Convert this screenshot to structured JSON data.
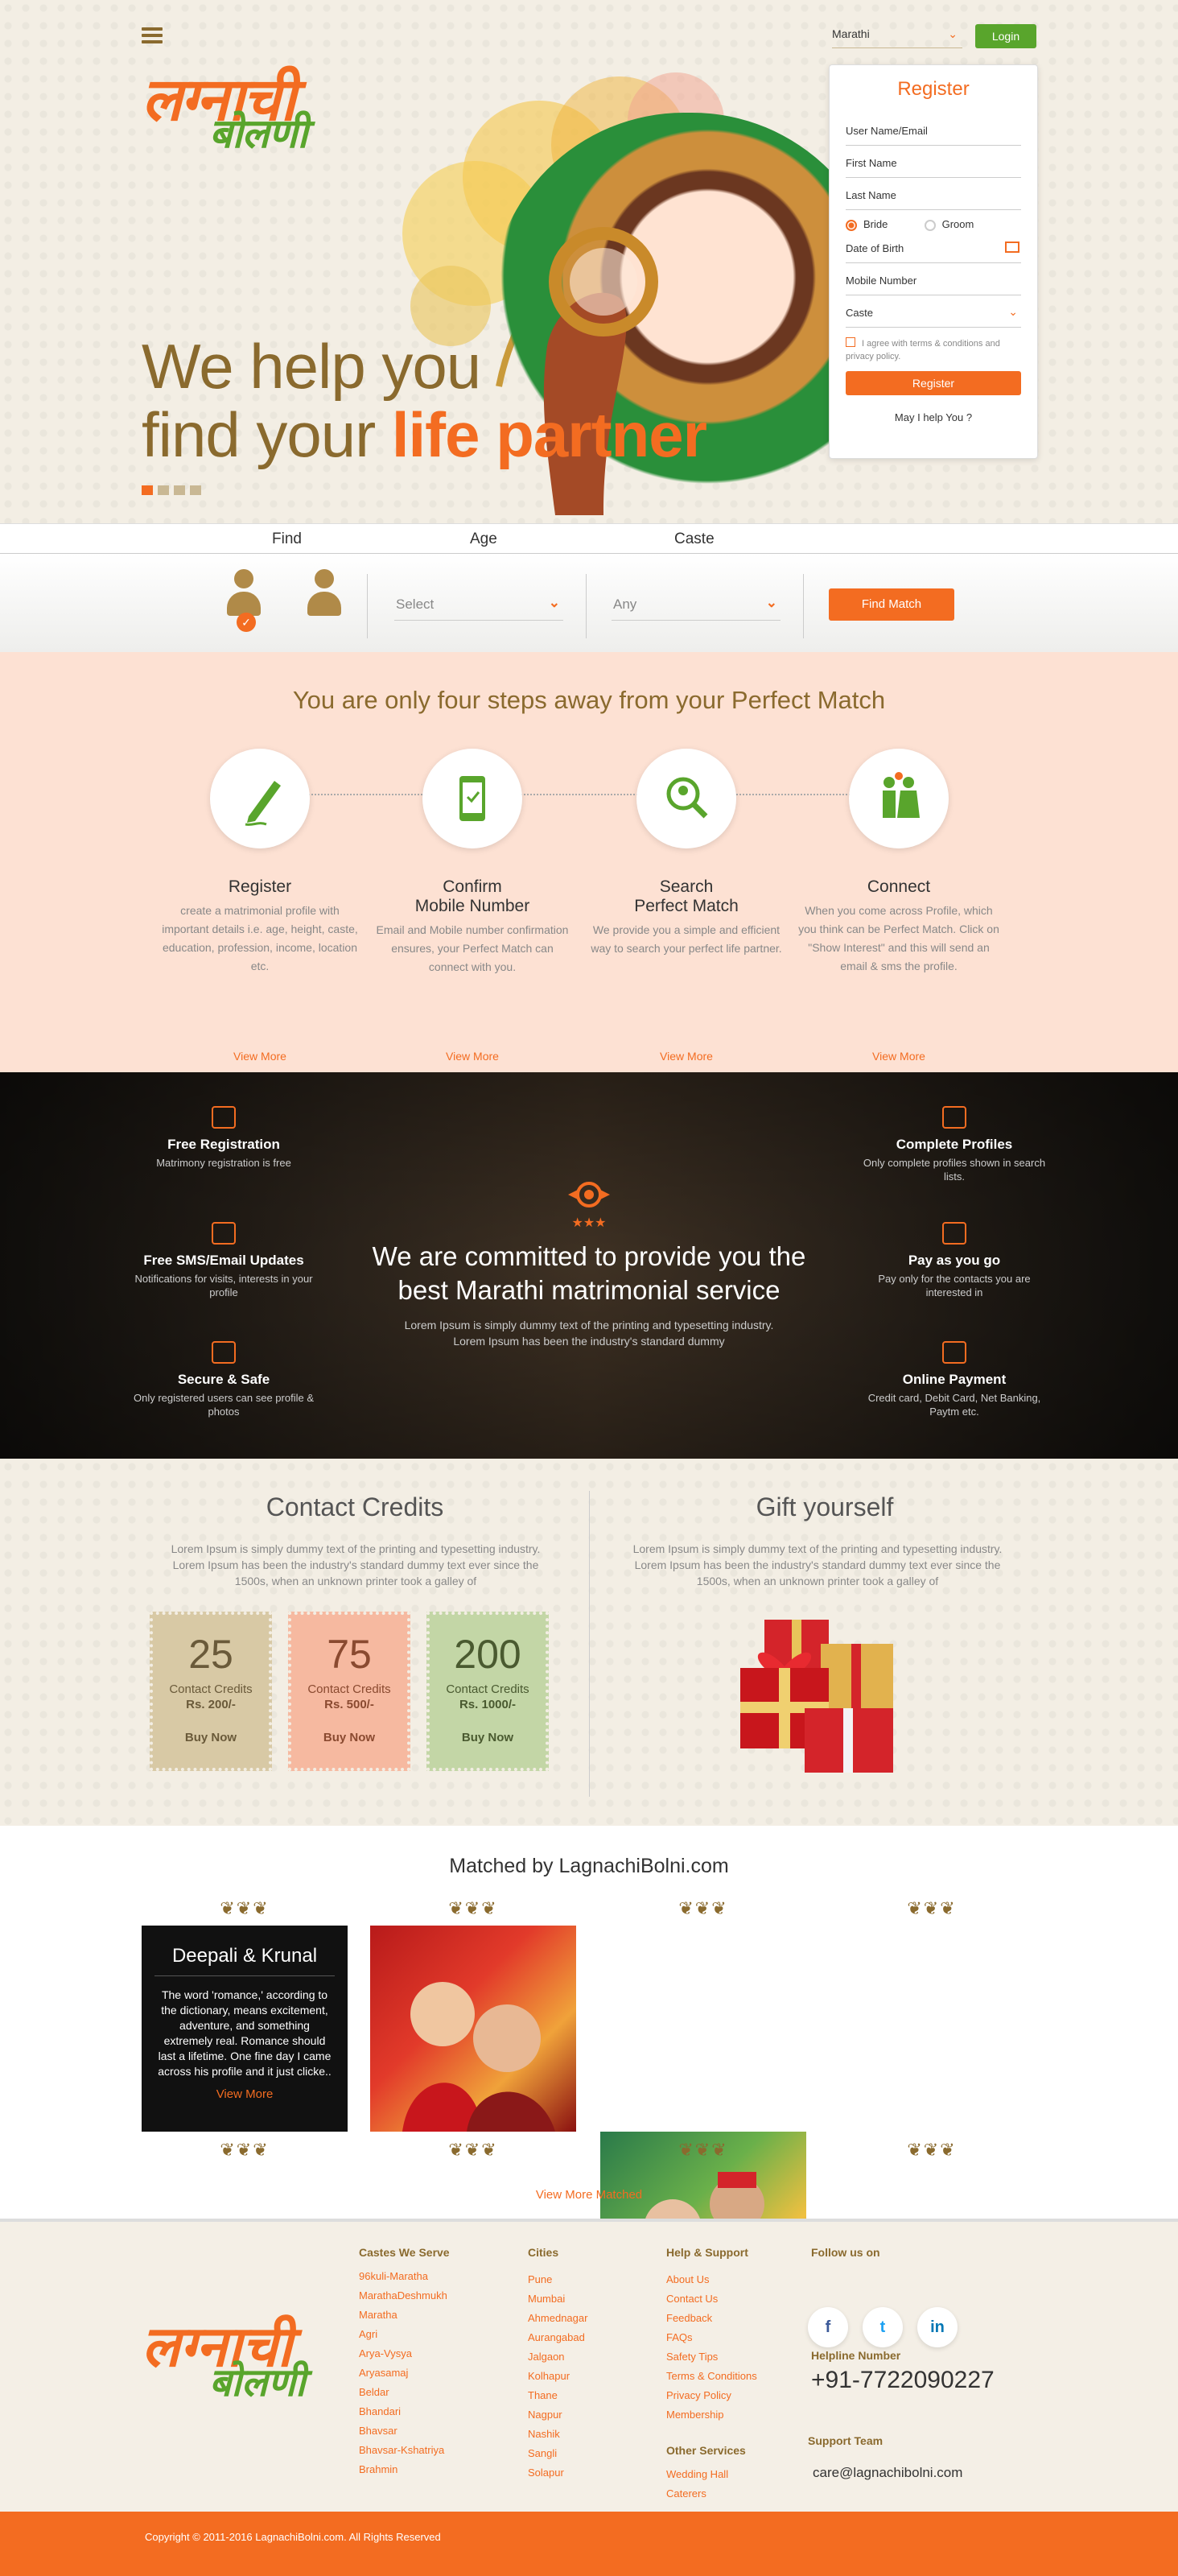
{
  "header": {
    "logo_line1": "लग्नाची",
    "logo_line2": "बोलणी",
    "language": "Marathi",
    "login_label": "Login",
    "hero_line1": "We help you",
    "hero_line2_plain": "find your ",
    "hero_line2_accent": "life partner"
  },
  "register": {
    "title": "Register",
    "username": "User Name/Email",
    "first_name": "First Name",
    "last_name": "Last Name",
    "gender_bride": "Bride",
    "gender_groom": "Groom",
    "dob": "Date of Birth",
    "mobile": "Mobile Number",
    "caste": "Caste",
    "agree": "I agree with terms & conditions and privacy policy.",
    "button": "Register",
    "help": "May I help You ?"
  },
  "search": {
    "label_find": "Find",
    "label_age": "Age",
    "label_caste": "Caste",
    "age_value": "Select",
    "caste_value": "Any",
    "button": "Find Match"
  },
  "steps": {
    "title": "You are only four steps away from your Perfect Match",
    "items": [
      {
        "title": "Register",
        "text": "create a matrimonial profile with important details i.e. age, height, caste, education, profession, income, location etc.",
        "link": "View More"
      },
      {
        "title": "Confirm\nMobile Number",
        "text": "Email and Mobile number confirmation ensures, your Perfect Match can connect with you.",
        "link": "View More"
      },
      {
        "title": "Search\nPerfect Match",
        "text": "We provide you a simple and efficient way to search your perfect life partner.",
        "link": "View More"
      },
      {
        "title": "Connect",
        "text": "When you come across Profile, which you think can be Perfect Match. Click on \"Show Interest\" and this will send an email & sms the profile.",
        "link": "View More"
      }
    ]
  },
  "commit": {
    "title": "We are committed to provide you the best Marathi matrimonial service",
    "text": "Lorem Ipsum is simply dummy text of the printing and typesetting industry. Lorem Ipsum has been the industry's standard dummy",
    "features": [
      {
        "title": "Free Registration",
        "text": "Matrimony registration is free"
      },
      {
        "title": "Free SMS/Email Updates",
        "text": "Notifications for visits, interests in your profile"
      },
      {
        "title": "Secure & Safe",
        "text": "Only registered users can see profile & photos"
      },
      {
        "title": "Complete Profiles",
        "text": "Only complete profiles shown in search lists."
      },
      {
        "title": "Pay as you go",
        "text": "Pay only for the contacts you are interested in"
      },
      {
        "title": "Online Payment",
        "text": "Credit card, Debit Card, Net Banking, Paytm etc."
      }
    ]
  },
  "credits": {
    "title": "Contact Credits",
    "text": "Lorem Ipsum is simply dummy text of the printing and typesetting industry. Lorem Ipsum has been the industry's standard dummy text ever since the 1500s, when an unknown printer took a galley of",
    "packs": [
      {
        "num": "25",
        "label": "Contact Credits",
        "price": "Rs. 200/-",
        "buy": "Buy Now",
        "color": "#d8c9a5",
        "text_color": "#6a5a3a"
      },
      {
        "num": "75",
        "label": "Contact Credits",
        "price": "Rs. 500/-",
        "buy": "Buy Now",
        "color": "#f6b9a0",
        "text_color": "#8a4a30"
      },
      {
        "num": "200",
        "label": "Contact Credits",
        "price": "Rs. 1000/-",
        "buy": "Buy Now",
        "color": "#c3d6a6",
        "text_color": "#4a5a30"
      }
    ]
  },
  "gift": {
    "title": "Gift yourself",
    "text": "Lorem Ipsum is simply dummy text of the printing and typesetting industry. Lorem Ipsum has been the industry's standard dummy text ever since the 1500s, when an unknown printer took a galley of"
  },
  "matched": {
    "title": "Matched by LagnachiBolni.com",
    "story_names": "Deepali & Krunal",
    "story_text": "The word 'romance,' according to the dictionary, means excitement, adventure, and something extremely real. Romance should last a lifetime. One fine day I came across his profile and it just clicke..",
    "story_link": "View More",
    "view_more": "View More Matched"
  },
  "footer": {
    "castes_title": "Castes We Serve",
    "castes": [
      "96kuli-Maratha",
      "MarathaDeshmukh",
      "Maratha",
      "Agri",
      "Arya-Vysya",
      "Aryasamaj",
      "Beldar",
      "Bhandari",
      "Bhavsar",
      "Bhavsar-Kshatriya",
      "Brahmin"
    ],
    "cities_title": "Cities",
    "cities": [
      "Pune",
      "Mumbai",
      "Ahmednagar",
      "Aurangabad",
      "Jalgaon",
      "Kolhapur",
      "Thane",
      "Nagpur",
      "Nashik",
      "Sangli",
      "Solapur"
    ],
    "help_title": "Help & Support",
    "help": [
      "About Us",
      "Contact Us",
      "Feedback",
      "FAQs",
      "Safety Tips",
      "Terms & Conditions",
      "Privacy Policy",
      "Membership"
    ],
    "other_title": "Other Services",
    "other": [
      "Wedding Hall",
      "Caterers"
    ],
    "follow_title": "Follow us on",
    "social": [
      "f",
      "t",
      "in"
    ],
    "helpline_title": "Helpline Number",
    "helpline": "+91-7722090227",
    "support_title": "Support Team",
    "support_email": "care@lagnachibolni.com",
    "copyright": "Copyright © 2011-2016 LagnachiBolni.com. All Rights Reserved"
  },
  "colors": {
    "accent": "#f36c21",
    "green": "#59a52c",
    "gold": "#8a6a2e"
  }
}
